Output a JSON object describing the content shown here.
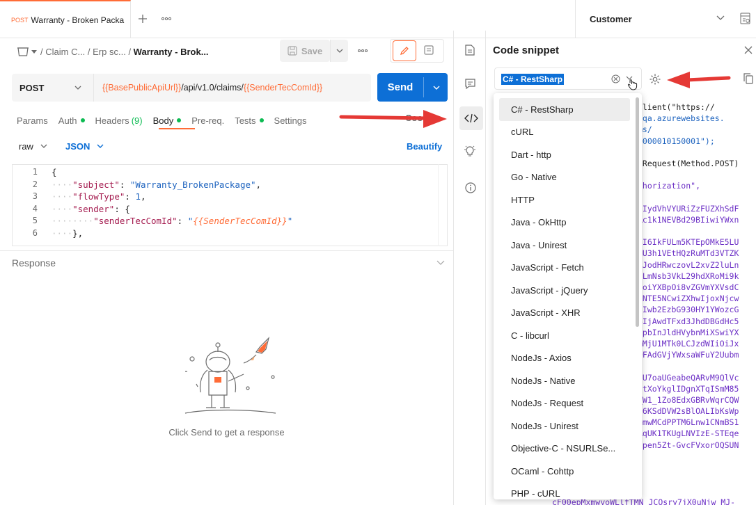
{
  "tab": {
    "method": "POST",
    "name": "Warranty - Broken Packa"
  },
  "environment": {
    "name": "Customer"
  },
  "breadcrumb": {
    "part1": "Claim C...",
    "part2": "Erp sc...",
    "current": "Warranty - Brok..."
  },
  "toolbar": {
    "save_label": "Save"
  },
  "request": {
    "method": "POST",
    "url_var1": "{{BasePublicApiUrl}}",
    "url_path": "/api/v1.0/claims/",
    "url_var2": "{{SenderTecComId}}",
    "send_label": "Send"
  },
  "request_tabs": {
    "params": "Params",
    "auth": "Auth",
    "headers": "Headers",
    "headers_count": "(9)",
    "body": "Body",
    "prereq": "Pre-req.",
    "tests": "Tests",
    "settings": "Settings",
    "cookies": "Cookie"
  },
  "body_options": {
    "raw": "raw",
    "json": "JSON",
    "beautify": "Beautify"
  },
  "editor": {
    "line_numbers": [
      "1",
      "2",
      "3",
      "4",
      "5",
      "6"
    ],
    "l1": "{",
    "l2_key": "\"subject\"",
    "l2_val": "\"Warranty_BrokenPackage\"",
    "l3_key": "\"flowType\"",
    "l3_val": "1",
    "l4_key": "\"sender\"",
    "l4_val": "{",
    "l5_key": "\"senderTecComId\"",
    "l5_val": "{{SenderTecComId}}",
    "l6": "},"
  },
  "response": {
    "title": "Response",
    "empty_text": "Click Send to get a response"
  },
  "code_snippet": {
    "title": "Code snippet",
    "selected_language": "C# - RestSharp",
    "code_lines": [
      [
        "Client(\"https://",
        "k"
      ],
      [
        "-qa.azurewebsites.",
        "s"
      ],
      [
        "ms/",
        "s"
      ],
      [
        "0000010150001\");",
        "s"
      ],
      [
        "",
        "k"
      ],
      [
        "tRequest(Method.POST)",
        "k"
      ],
      [
        "",
        "k"
      ],
      [
        "thorization\",",
        "p"
      ],
      [
        "",
        "k"
      ],
      [
        "nIydVhVYURiZzFUZXhSdF",
        "p"
      ],
      [
        "Rc1k1NEVBd29BIiwiYWxn",
        "p"
      ],
      [
        "",
        "k"
      ],
      [
        "SI6IkFULm5KTEpOMkE5LU",
        "p"
      ],
      [
        "NU3h1VEtHQzRuMTd3VTZK",
        "p"
      ],
      [
        "lJodHRwczovL2xvZ2luLn",
        "p"
      ],
      [
        "lLmNsb3VkL29hdXRoMi9k",
        "p"
      ],
      [
        "joiYXBpOi8vZGVmYXVsdC",
        "p"
      ],
      [
        "lNTE5NCwiZXhwIjoxNjcw",
        "p"
      ],
      [
        "lIwb2EzbG930HY1YWozcG",
        "p"
      ],
      [
        "SIjAwdTFxd3JhdDBGdHc5",
        "p"
      ],
      [
        "jpbInJldHVybnMiXSwiYX",
        "p"
      ],
      [
        "mMjU1MTk0LCJzdWIiOiJx",
        "p"
      ],
      [
        "DFAdGVjYWxsaWFuY2Uubm",
        "p"
      ],
      [
        "",
        "k"
      ],
      [
        "dU7oaUGeabeQARvM9QlVc",
        "p"
      ],
      [
        "utXoYkglIDgnXTqISmM85",
        "p"
      ],
      [
        "_W1_1Zo8EdxGBRvWqrCQW",
        "p"
      ],
      [
        "q6KSdDVW2sBlOALIbKsWp",
        "p"
      ],
      [
        "omwMCdPPTM6Lnw1CNmBS1",
        "p"
      ],
      [
        "AqUK1TKUgLNVIzE-STEqe",
        "p"
      ],
      [
        "dpen5Zt-GvcFVxorOQSUN",
        "p"
      ]
    ],
    "bottom_line": "cF00epMxmwyoWLlfTMN_JCOsry7jX0uNjw_MJ-"
  },
  "languages": [
    "C# - RestSharp",
    "cURL",
    "Dart - http",
    "Go - Native",
    "HTTP",
    "Java - OkHttp",
    "Java - Unirest",
    "JavaScript - Fetch",
    "JavaScript - jQuery",
    "JavaScript - XHR",
    "C - libcurl",
    "NodeJs - Axios",
    "NodeJs - Native",
    "NodeJs - Request",
    "NodeJs - Unirest",
    "Objective-C - NSURLSe...",
    "OCaml - Cohttp",
    "PHP - cURL"
  ],
  "colors": {
    "accent": "#ff6c37",
    "primary": "#0d6fd6",
    "arrow": "#e53935"
  }
}
